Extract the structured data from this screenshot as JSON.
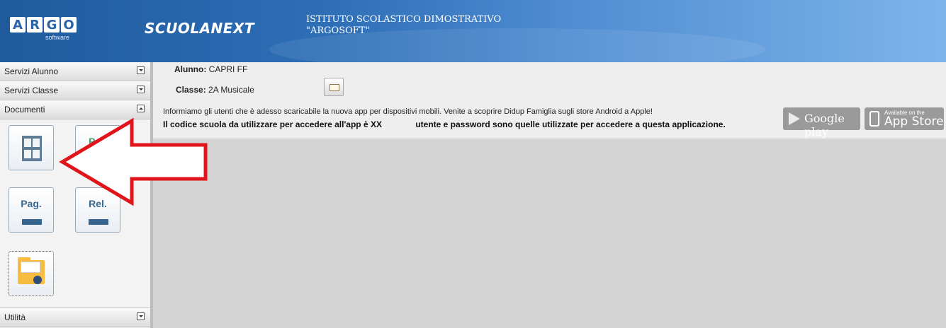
{
  "header": {
    "logo_letters": [
      "A",
      "R",
      "G",
      "O"
    ],
    "logo_sub": "software",
    "app_name": "SCUOLANEXT",
    "school_line1": "ISTITUTO SCOLASTICO DIMOSTRATIVO",
    "school_line2": "\"ARGOSOFT\""
  },
  "sidebar": {
    "menus": [
      {
        "label": "Servizi Alunno",
        "state": "collapsed"
      },
      {
        "label": "Servizi Classe",
        "state": "collapsed"
      },
      {
        "label": "Documenti",
        "state": "expanded"
      },
      {
        "label": "Utilità",
        "state": "collapsed"
      }
    ],
    "documents": {
      "tile_pagella_label": "Pag",
      "tile_pag_label": "Pag.",
      "tile_rel_label": "Rel."
    }
  },
  "main": {
    "student_label": "Alunno:",
    "student_value": "CAPRI FF",
    "class_label": "Classe:",
    "class_value": "2A Musicale",
    "notice_line1": "Informiamo gli utenti che è adesso scaricabile la nuova app per dispositivi mobili. Venite a scoprire Didup Famiglia sugli store Android a Apple!",
    "notice_line2_a": "Il codice scuola da utilizzare per accedere all'app è XX",
    "notice_line2_b": "utente e password sono quelle utilizzate per accedere a questa applicazione.",
    "google_play_label": "Google play",
    "app_store_small": "Available on the",
    "app_store_label": "App Store"
  },
  "colors": {
    "header_dark": "#1f5a9d",
    "header_light": "#7eb4ea",
    "arrow_red": "#e0141a",
    "tile_blue": "#36658f",
    "folder_yellow": "#f6bb3f"
  }
}
